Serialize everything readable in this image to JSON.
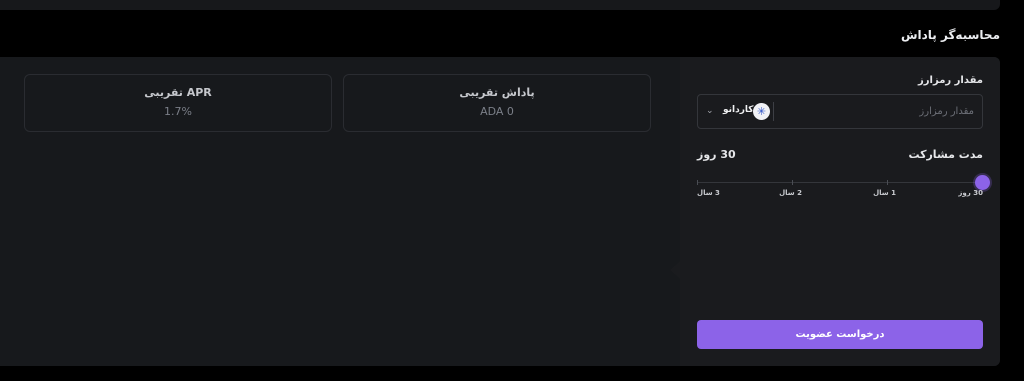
{
  "section": {
    "title": "محاسبه‌گر پاداش"
  },
  "stats": {
    "apr": {
      "label": "APR تقریبی",
      "value": "1.7%"
    },
    "reward": {
      "label": "پاداش تقریبی",
      "value": "ADA 0"
    }
  },
  "calculator": {
    "amount_label": "مقدار رمزارز",
    "amount_placeholder": "مقدار رمزارز",
    "coin": {
      "name": "کاردانو",
      "icon": "cardano-icon"
    },
    "duration_label": "مدت مشارکت",
    "duration_value": "30 روز",
    "slider": {
      "ticks": [
        "30 روز",
        "1 سال",
        "2 سال",
        "3 سال"
      ],
      "selected_index": 0
    },
    "submit_label": "درخواست عضویت"
  },
  "colors": {
    "accent": "#8c63e8",
    "panel": "#17191c",
    "background": "#000000"
  }
}
